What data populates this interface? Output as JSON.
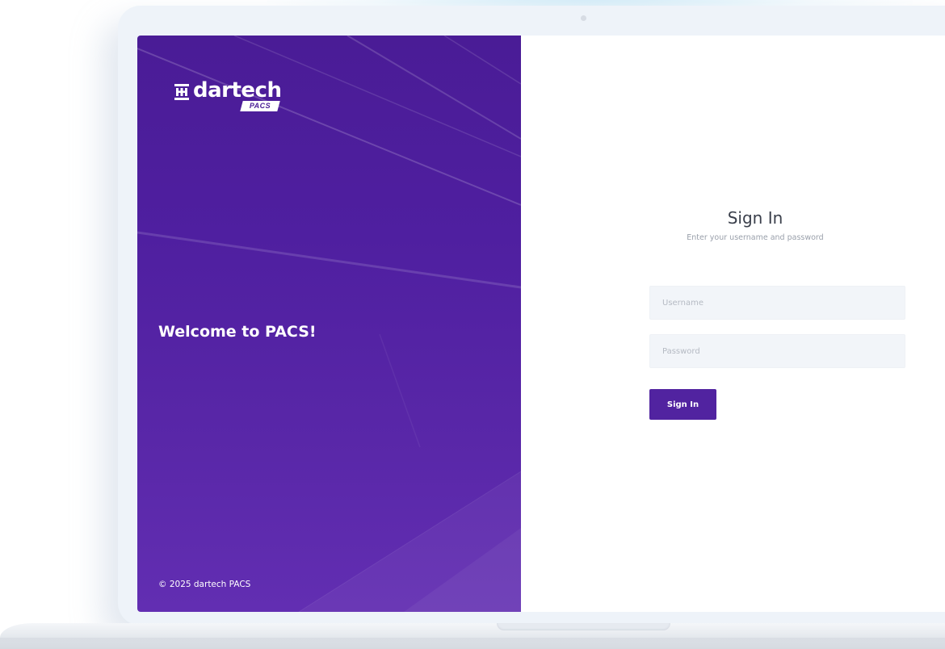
{
  "brand": {
    "logo_icon": "dartech-logo-icon",
    "logo_word": "dartech",
    "logo_badge": "PACS",
    "primary_color": "#5123a0"
  },
  "left_panel": {
    "welcome": "Welcome to PACS!",
    "copyright": "© 2025 dartech PACS"
  },
  "signin": {
    "title": "Sign In",
    "subtitle": "Enter your username and password",
    "username": {
      "placeholder": "Username",
      "value": ""
    },
    "password": {
      "placeholder": "Password",
      "value": ""
    },
    "button_label": "Sign In"
  }
}
